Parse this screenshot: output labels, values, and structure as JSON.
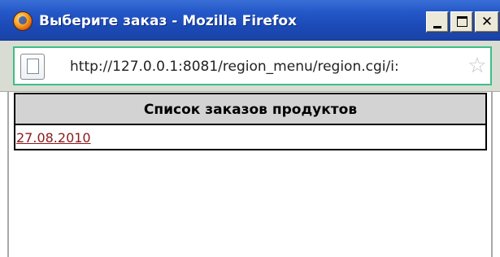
{
  "window": {
    "title": "Выберите заказ - Mozilla Firefox",
    "buttons": {
      "minimize": "_",
      "maximize": "□",
      "close": "✕"
    }
  },
  "urlbar": {
    "url": "http://127.0.0.1:8081/region_menu/region.cgi/i:",
    "icons": {
      "page": "page-icon",
      "bookmark": "star-icon"
    }
  },
  "table": {
    "header": "Список заказов продуктов",
    "rows": [
      {
        "link": "27.08.2010"
      }
    ]
  },
  "colors": {
    "titlebar": "#1b49b4",
    "urlbar_border": "#3dbf86",
    "link": "#8b1a1a",
    "table_header_bg": "#d3d3d3"
  }
}
